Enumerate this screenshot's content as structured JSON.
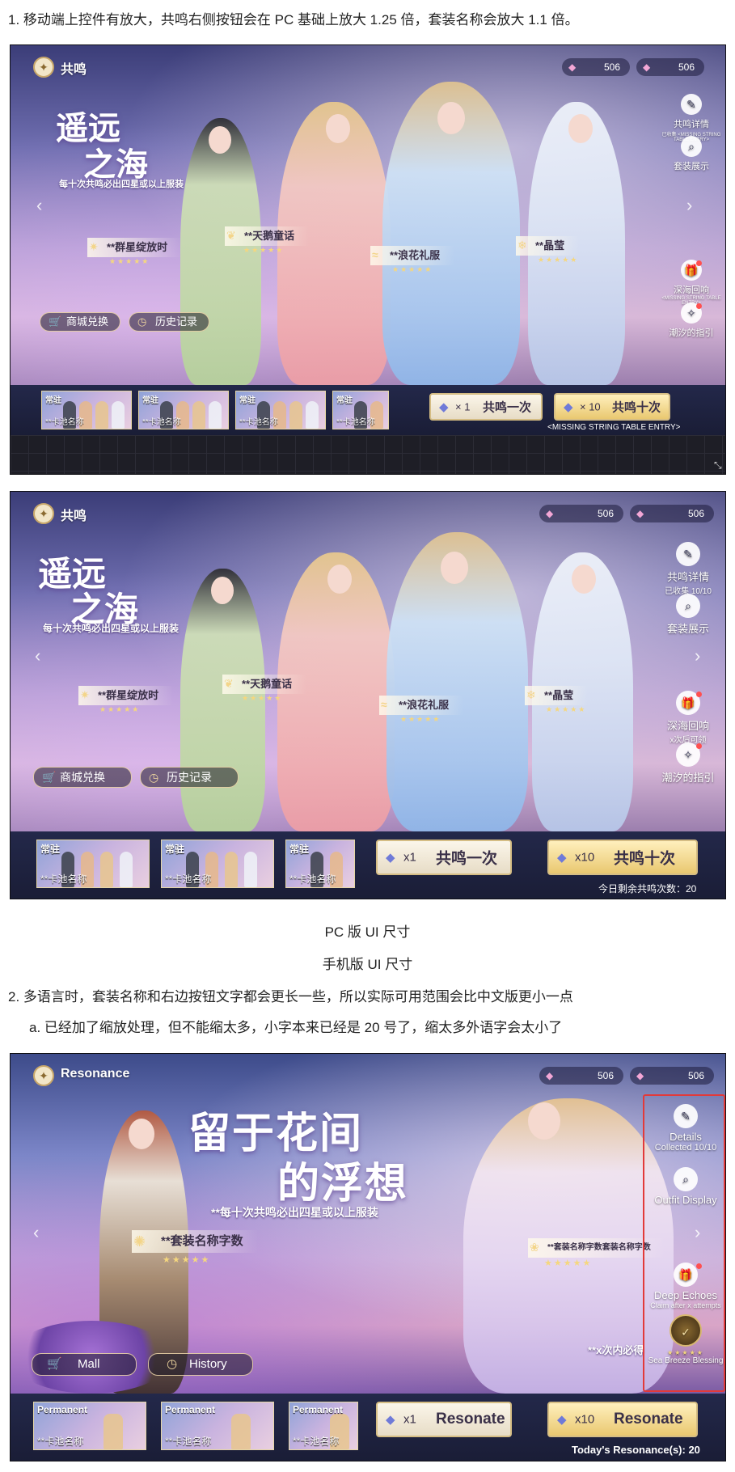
{
  "notes": {
    "item1": "1.  移动端上控件有放大，共鸣右侧按钮会在 PC 基础上放大 1.25 倍，套装名称会放大 1.1 倍。",
    "caption_pc": "PC 版 UI 尺寸",
    "caption_mobile": "手机版 UI 尺寸",
    "item2": "2.  多语言时，套装名称和右边按钮文字都会更长一些，所以实际可用范围会比中文版更小一点",
    "item2a": "a.  已经加了缩放处理，但不能缩太多，小字本来已经是 20 号了，缩太多外语字会太小了"
  },
  "shot1": {
    "title": "共鸣",
    "currency": [
      "506",
      "506"
    ],
    "big_title": [
      "遥远",
      "之海"
    ],
    "subtitle": "每十次共鸣必出四星或以上服装",
    "outfits": [
      "**群星绽放时",
      "**天鹅童话",
      "**浪花礼服",
      "**晶莹"
    ],
    "stars": "★★★★★",
    "side": {
      "details": "共鸣详情",
      "details_sub": "已收集 <MISSING STRING TABLE ENTRY>",
      "outfit_display": "套装展示",
      "echoes": "深海回响",
      "echoes_sub": "<MISSING STRING TABLE ENTRY>",
      "guide": "潮汐的指引"
    },
    "mall": "商城兑换",
    "history": "历史记录",
    "card_tag": "常驻",
    "card_name": "**卡池名称",
    "pull1_count": "× 1",
    "pull1": "共鸣一次",
    "pull10_count": "× 10",
    "pull10": "共鸣十次",
    "status": "<MISSING STRING TABLE ENTRY>"
  },
  "shot2": {
    "title": "共鸣",
    "currency": [
      "506",
      "506"
    ],
    "big_title": [
      "遥远",
      "之海"
    ],
    "subtitle": "每十次共鸣必出四星或以上服装",
    "outfits": [
      "**群星绽放时",
      "**天鹅童话",
      "**浪花礼服",
      "**晶莹"
    ],
    "stars": "★★★★★",
    "side": {
      "details": "共鸣详情",
      "details_sub": "已收集 10/10",
      "outfit_display": "套装展示",
      "echoes": "深海回响",
      "echoes_sub": "x次后可领",
      "guide": "潮汐的指引"
    },
    "mall": "商城兑换",
    "history": "历史记录",
    "card_tag": "常驻",
    "card_name": "**卡池名称",
    "pull1_count": "x1",
    "pull1": "共鸣一次",
    "pull10_count": "x10",
    "pull10": "共鸣十次",
    "status": "今日剩余共鸣次数：20"
  },
  "shot3": {
    "title": "Resonance",
    "currency": [
      "506",
      "506"
    ],
    "big_title": [
      "留于花间",
      "的浮想"
    ],
    "subtitle": "**每十次共鸣必出四星或以上服装",
    "outfits": [
      "**套装名称字数",
      "**套装名称字数套装名称字数"
    ],
    "stars": "★★★★★",
    "side": {
      "details": "Details",
      "details_sub": "Collected 10/10",
      "outfit_display": "Outfit Display",
      "echoes": "Deep Echoes",
      "echoes_sub": "Claim after x attempts",
      "guide": "Sea Breeze Blessing"
    },
    "guarantee": "**x次内必得",
    "mall": "Mall",
    "history": "History",
    "card_tag": "Permanent",
    "card_name": "**卡池名称",
    "pull1_count": "x1",
    "pull1": "Resonate",
    "pull10_count": "x10",
    "pull10": "Resonate",
    "status": "Today's Resonance(s): 20"
  }
}
